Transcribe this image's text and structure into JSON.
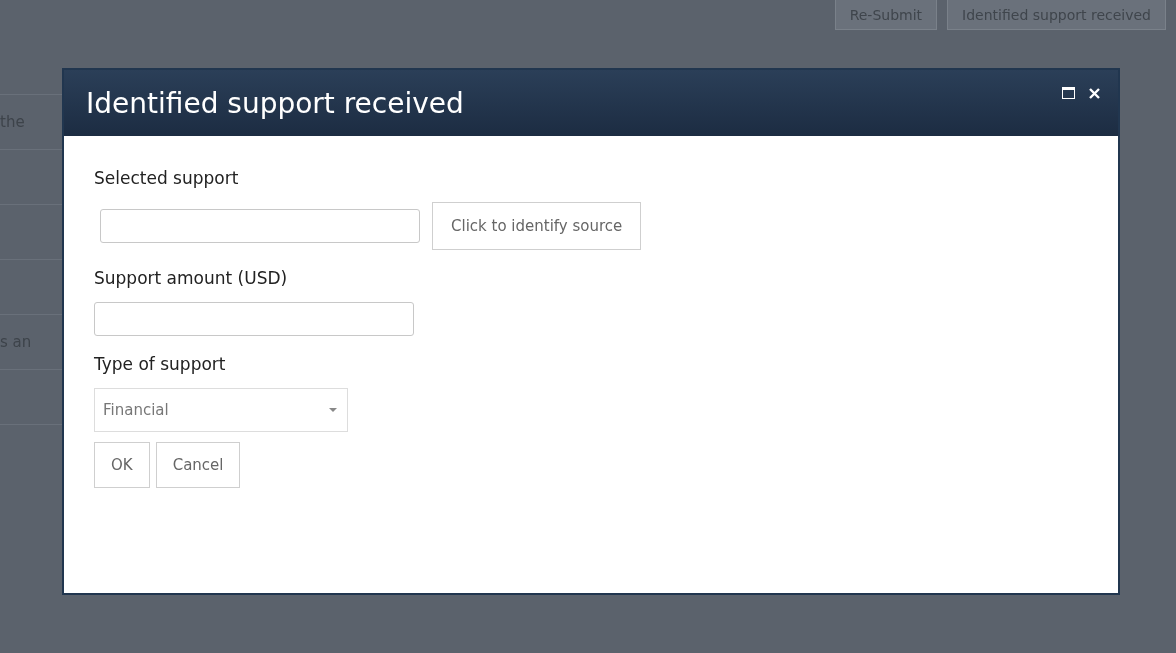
{
  "background": {
    "buttons": [
      "Re-Submit",
      "Identified support received"
    ],
    "fragments": [
      "the",
      "s an"
    ]
  },
  "dialog": {
    "title": "Identified support received",
    "fields": [
      {
        "kind": "lookup",
        "label": "Selected support",
        "button": "Click to identify source"
      },
      {
        "kind": "text",
        "label": "Support amount (USD)"
      },
      {
        "kind": "select",
        "label": "Type of support",
        "value": "Financial"
      }
    ],
    "buttons": [
      "OK",
      "Cancel"
    ]
  }
}
